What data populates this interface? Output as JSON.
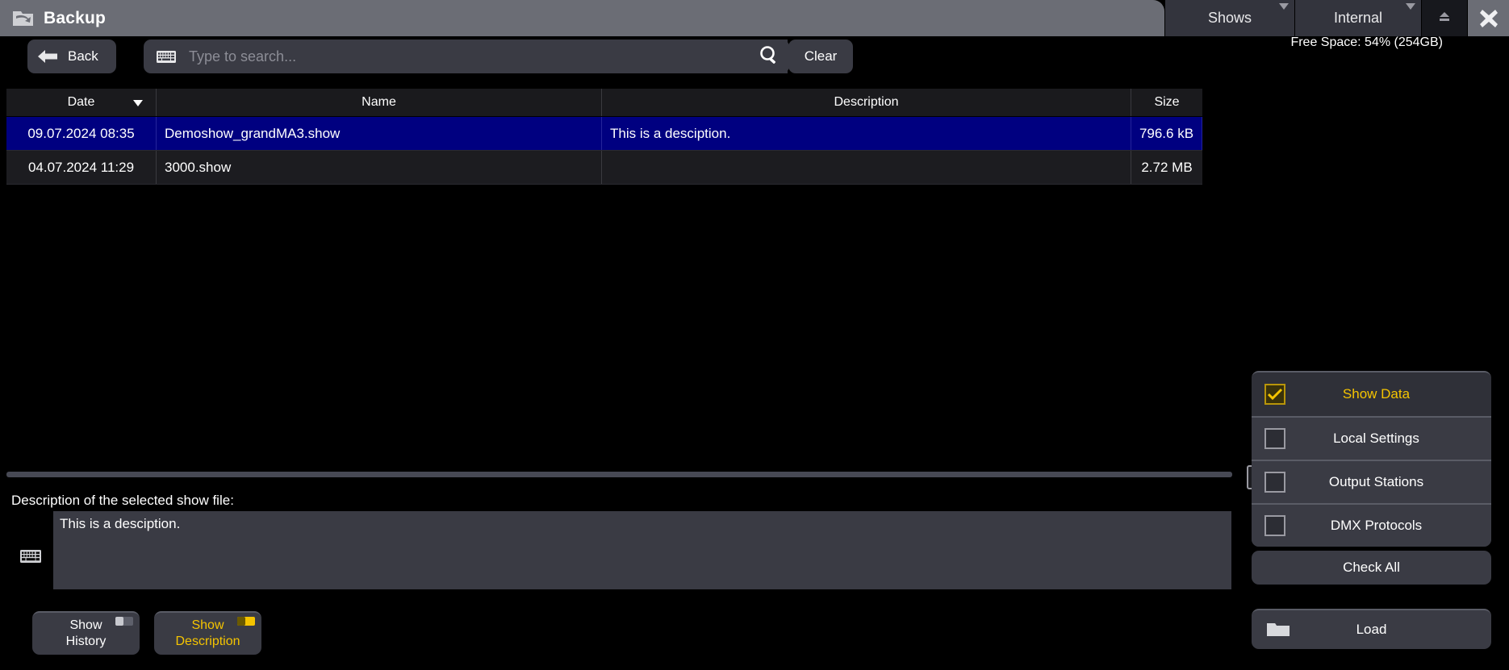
{
  "titlebar": {
    "title": "Backup",
    "icon": "backup-folder-icon",
    "shows_label": "Shows",
    "internal_label": "Internal",
    "eject_icon": "eject-icon",
    "close_icon": "close-icon"
  },
  "status": {
    "free_space": "Free Space: 54% (254GB)"
  },
  "toolbar": {
    "back_label": "Back",
    "search_placeholder": "Type to search...",
    "search_value": "",
    "search_icon": "magnifier-icon",
    "keyboard_icon": "keyboard-icon",
    "clear_label": "Clear"
  },
  "table": {
    "columns": [
      {
        "label": "Date",
        "sorted": true
      },
      {
        "label": "Name",
        "sorted": false
      },
      {
        "label": "Description",
        "sorted": false
      },
      {
        "label": "Size",
        "sorted": false
      }
    ],
    "rows": [
      {
        "date": "09.07.2024 08:35",
        "name": "Demoshow_grandMA3.show",
        "description": "This is a desciption.",
        "size": "796.6 kB",
        "selected": true
      },
      {
        "date": "04.07.2024 11:29",
        "name": "3000.show",
        "description": "",
        "size": "2.72 MB",
        "selected": false
      }
    ]
  },
  "description_panel": {
    "label": "Description of the selected show file:",
    "value": "This is a desciption.",
    "keyboard_icon": "keyboard-icon",
    "show_history_line1": "Show",
    "show_history_line2": "History",
    "show_description_line1": "Show",
    "show_description_line2": "Description"
  },
  "options": {
    "items": [
      {
        "label": "Show Data",
        "checked": true
      },
      {
        "label": "Local Settings",
        "checked": false
      },
      {
        "label": "Output Stations",
        "checked": false
      },
      {
        "label": "DMX Protocols",
        "checked": false
      }
    ],
    "check_all_label": "Check All",
    "load_label": "Load",
    "folder_icon": "folder-icon"
  },
  "colors": {
    "accent": "#f5c400",
    "selection": "#000080",
    "titlebar": "#6b6d75",
    "panel": "#3a3b44"
  }
}
